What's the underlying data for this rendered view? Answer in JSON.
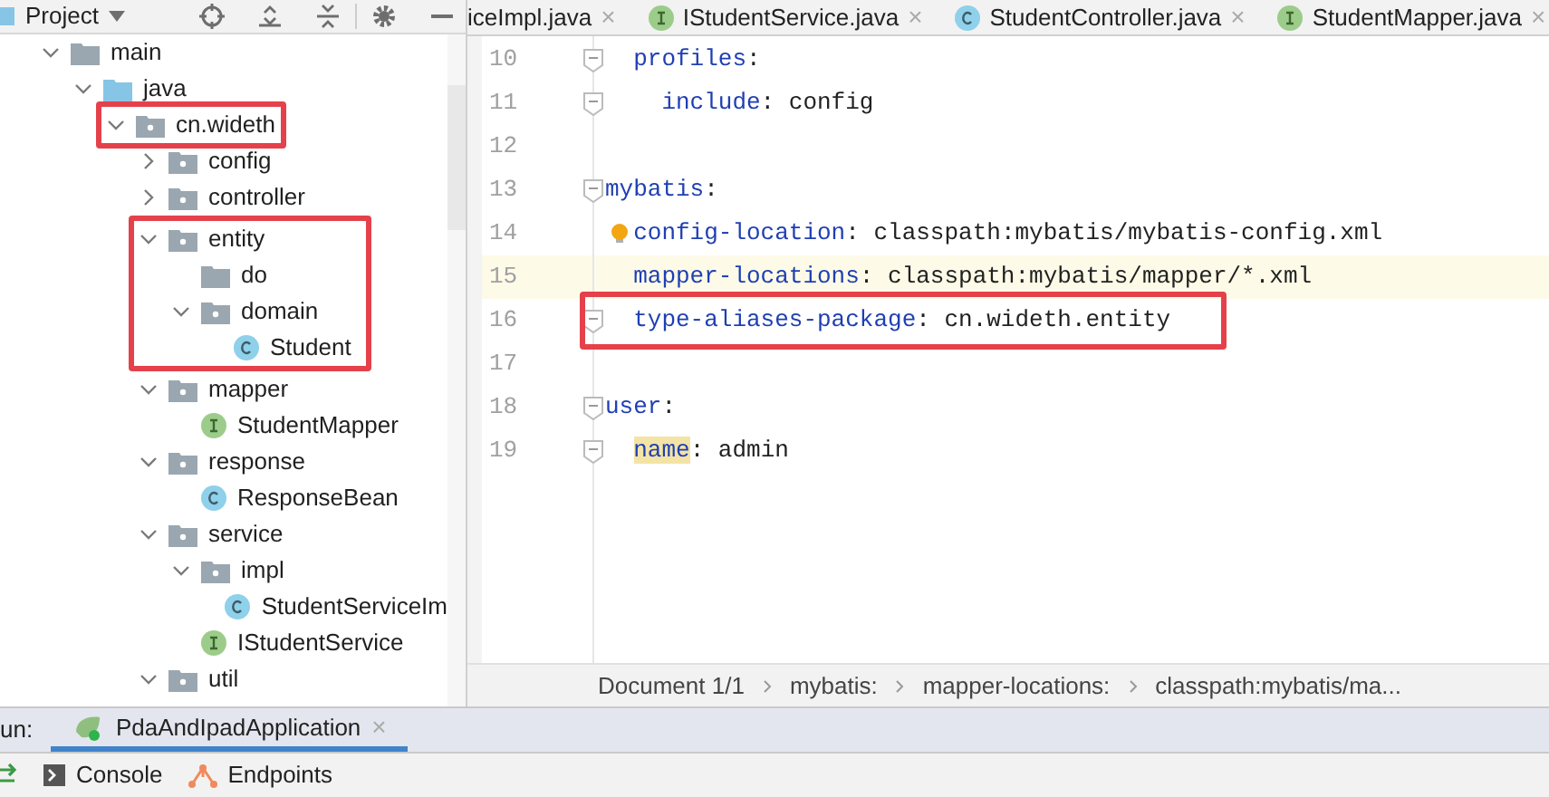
{
  "project_panel": {
    "title": "Project",
    "tree": [
      {
        "label": "main",
        "kind": "folder",
        "expanded": true,
        "highlight": false,
        "children": [
          {
            "label": "java",
            "kind": "source",
            "expanded": true,
            "highlight": false,
            "children": [
              {
                "label": "cn.wideth",
                "kind": "package",
                "expanded": true,
                "highlight": true,
                "highlight_includes_children": false,
                "children": [
                  {
                    "label": "config",
                    "kind": "package",
                    "expanded": false,
                    "highlight": false
                  },
                  {
                    "label": "controller",
                    "kind": "package",
                    "expanded": false,
                    "highlight": false
                  },
                  {
                    "label": "entity",
                    "kind": "package",
                    "expanded": true,
                    "highlight": true,
                    "highlight_includes_children": true,
                    "children": [
                      {
                        "label": "do",
                        "kind": "folder",
                        "highlight": false
                      },
                      {
                        "label": "domain",
                        "kind": "package",
                        "expanded": true,
                        "highlight": false,
                        "children": [
                          {
                            "label": "Student",
                            "kind": "class",
                            "highlight": false
                          }
                        ]
                      }
                    ]
                  },
                  {
                    "label": "mapper",
                    "kind": "package",
                    "expanded": true,
                    "highlight": false,
                    "children": [
                      {
                        "label": "StudentMapper",
                        "kind": "interface",
                        "highlight": false
                      }
                    ]
                  },
                  {
                    "label": "response",
                    "kind": "package",
                    "expanded": true,
                    "highlight": false,
                    "children": [
                      {
                        "label": "ResponseBean",
                        "kind": "class",
                        "highlight": false
                      }
                    ]
                  },
                  {
                    "label": "service",
                    "kind": "package",
                    "expanded": true,
                    "highlight": false,
                    "children": [
                      {
                        "label": "impl",
                        "kind": "package",
                        "expanded": true,
                        "highlight": false,
                        "children": [
                          {
                            "label": "StudentServiceIm",
                            "kind": "class",
                            "highlight": false
                          }
                        ]
                      },
                      {
                        "label": "IStudentService",
                        "kind": "interface",
                        "highlight": false
                      }
                    ]
                  },
                  {
                    "label": "util",
                    "kind": "package",
                    "expanded": true,
                    "highlight": false
                  }
                ]
              }
            ]
          }
        ]
      }
    ]
  },
  "editor_tabs": [
    {
      "label": "iceImpl.java",
      "close": "×",
      "selected": false
    },
    {
      "label": "IStudentService.java",
      "kind": "interface",
      "close": "×",
      "selected": false
    },
    {
      "label": "StudentController.java",
      "kind": "class",
      "close": "×",
      "selected": false
    },
    {
      "label": "StudentMapper.java",
      "kind": "interface",
      "close": "×",
      "selected": false
    }
  ],
  "code_lines": [
    {
      "children": [
        {
          "number": "10",
          "key": "profiles",
          "value": ":",
          "fold": true,
          "current": false,
          "bulb": false,
          "highlight": false,
          "key_marked": false,
          "children": [
            {
              "number": "11",
              "key": "include",
              "value": ": config",
              "fold": true,
              "current": false,
              "bulb": false,
              "highlight": false,
              "key_marked": false
            }
          ]
        }
      ]
    },
    {
      "number": "12",
      "fold": false,
      "current": false,
      "bulb": false,
      "highlight": false
    },
    {
      "number": "13",
      "key": "mybatis",
      "value": ":",
      "fold": true,
      "current": false,
      "bulb": false,
      "highlight": false,
      "key_marked": false,
      "children": [
        {
          "number": "14",
          "key": "config-location",
          "value": ": classpath:mybatis/mybatis-config.xml",
          "fold": false,
          "current": false,
          "bulb": true,
          "highlight": false,
          "key_marked": false
        },
        {
          "number": "15",
          "key": "mapper-locations",
          "value": ": classpath:mybatis/mapper/*.xml",
          "fold": false,
          "current": true,
          "bulb": false,
          "highlight": false,
          "key_marked": false
        },
        {
          "number": "16",
          "key": "type-aliases-package",
          "value": ": cn.wideth.entity",
          "fold": true,
          "current": false,
          "bulb": false,
          "highlight": true,
          "key_marked": false
        }
      ]
    },
    {
      "number": "17",
      "fold": false,
      "current": false,
      "bulb": false,
      "highlight": false
    },
    {
      "number": "18",
      "key": "user",
      "value": ":",
      "fold": true,
      "current": false,
      "bulb": false,
      "highlight": false,
      "key_marked": false,
      "children": [
        {
          "number": "19",
          "key": "name",
          "value": ": admin",
          "fold": true,
          "current": false,
          "bulb": false,
          "highlight": false,
          "key_marked": true
        }
      ]
    }
  ],
  "breadcrumbs": [
    "Document 1/1",
    "mybatis:",
    "mapper-locations:",
    "classpath:mybatis/ma..."
  ],
  "run_bar": {
    "label": "un:",
    "tab": {
      "label": "PdaAndIpadApplication",
      "close": "×",
      "selected": true
    }
  },
  "bottom_tools": [
    {
      "label": "Console",
      "kind": "console"
    },
    {
      "label": "Endpoints",
      "kind": "endpoints"
    }
  ]
}
